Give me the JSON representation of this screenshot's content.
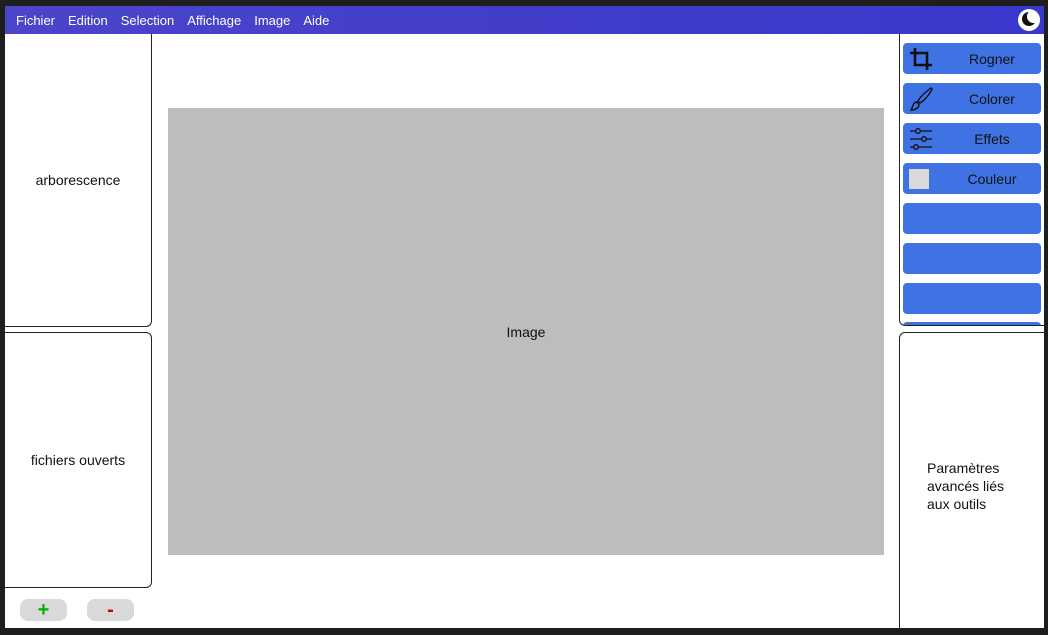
{
  "menu": {
    "items": [
      {
        "label": "Fichier"
      },
      {
        "label": "Edition"
      },
      {
        "label": "Selection"
      },
      {
        "label": "Affichage"
      },
      {
        "label": "Image"
      },
      {
        "label": "Aide"
      }
    ],
    "theme_icon": "moon-icon"
  },
  "left": {
    "tree_label": "arborescence",
    "open_files_label": "fichiers ouverts",
    "add_label": "+",
    "remove_label": "-"
  },
  "canvas": {
    "label": "Image"
  },
  "tools": {
    "items": [
      {
        "label": "Rogner",
        "icon": "crop-icon"
      },
      {
        "label": "Colorer",
        "icon": "brush-icon"
      },
      {
        "label": "Effets",
        "icon": "sliders-icon"
      },
      {
        "label": "Couleur",
        "icon": "color-swatch"
      },
      {
        "label": ""
      },
      {
        "label": ""
      },
      {
        "label": ""
      }
    ]
  },
  "params": {
    "label": "Paramètres avancés liés aux outils"
  },
  "colors": {
    "menubar": "#3a37cc",
    "tool_button": "#3f73e3",
    "canvas": "#bdbdbd",
    "add": "#00b000",
    "remove": "#d00000"
  }
}
